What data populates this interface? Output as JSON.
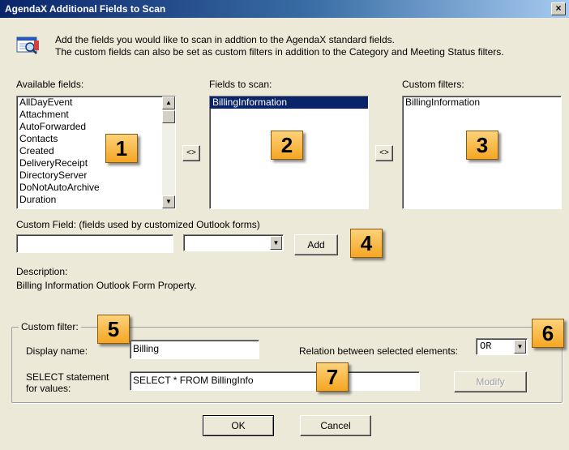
{
  "window": {
    "title": "AgendaX Additional Fields to Scan",
    "close_glyph": "×"
  },
  "intro": {
    "line1": "Add the fields you would like to scan in addtion to the AgendaX standard fields.",
    "line2": "The custom fields can also be set as custom filters in addition to the Category and Meeting Status filters.",
    "icon": "scan-fields-icon"
  },
  "available_fields": {
    "label": "Available fields:",
    "items": [
      "AllDayEvent",
      "Attachment",
      "AutoForwarded",
      "Contacts",
      "Created",
      "DeliveryReceipt",
      "DirectoryServer",
      "DoNotAutoArchive",
      "Duration"
    ]
  },
  "fields_to_scan": {
    "label": "Fields to scan:",
    "items": [
      "BillingInformation"
    ],
    "selected_index": 0
  },
  "custom_filters": {
    "label": "Custom filters:",
    "items": [
      "BillingInformation"
    ]
  },
  "move_buttons": {
    "left": "<>",
    "right": "<>"
  },
  "custom_field": {
    "label": "Custom Field:  (fields used by customized Outlook forms)",
    "value": "",
    "combo_value": "",
    "add_label": "Add"
  },
  "description": {
    "label": "Description:",
    "text": "Billing Information Outlook Form Property."
  },
  "custom_filter": {
    "legend": "Custom filter:",
    "display_name_label": "Display name:",
    "display_name_value": "Billing",
    "relation_label": "Relation between selected elements:",
    "relation_value": "OR",
    "select_label_line1": "SELECT statement",
    "select_label_line2": "for values:",
    "select_value": "SELECT * FROM BillingInfo",
    "modify_label": "Modify"
  },
  "footer": {
    "ok_label": "OK",
    "cancel_label": "Cancel"
  },
  "callouts": [
    "1",
    "2",
    "3",
    "4",
    "5",
    "6",
    "7"
  ],
  "colors": {
    "callout": "#f5a623",
    "selection": "#0a246a",
    "dialog_bg": "#ece9d8"
  }
}
